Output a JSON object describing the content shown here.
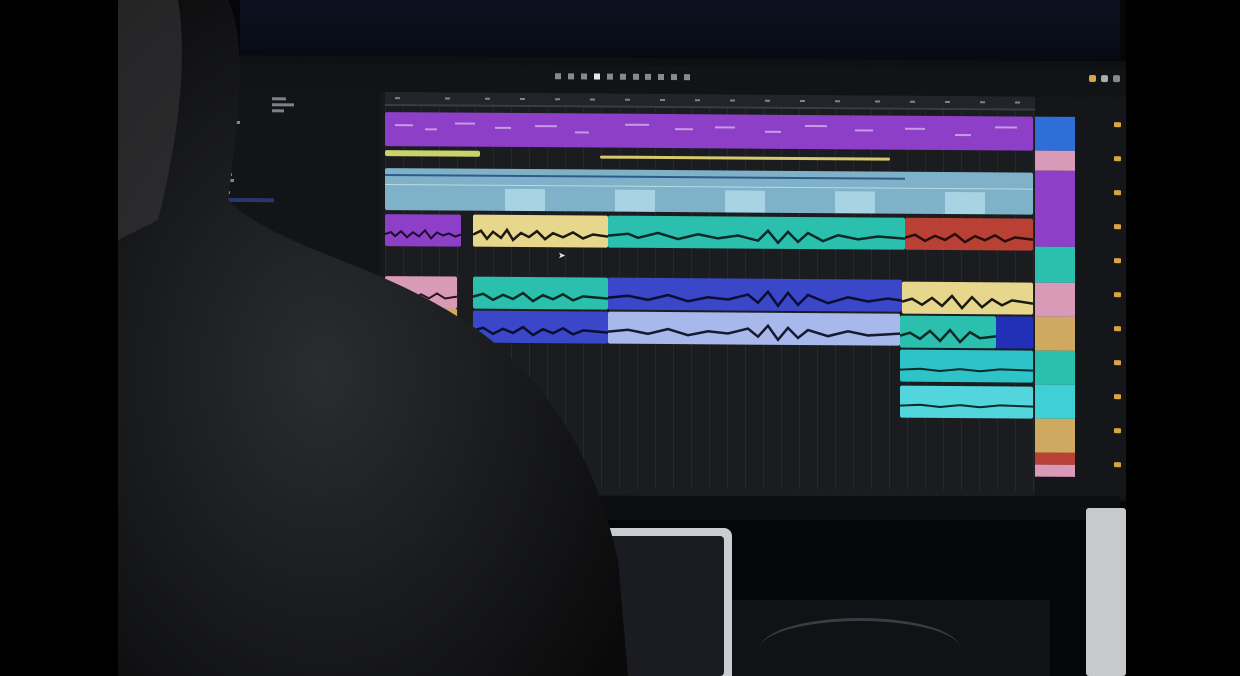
{
  "colors": {
    "purple": "#8d3fc8",
    "yellow": "#e6d78c",
    "teal": "#2bbfae",
    "red": "#b94035",
    "pink": "#d99ab8",
    "tan": "#cfa95f",
    "blue": "#3947c8",
    "lightblue": "#a9b8ea",
    "cyan": "#3fd0d6",
    "skyblock": "#9ed6e6",
    "accent": "#d9a441"
  },
  "icons": {
    "play": "play-icon",
    "stop": "stop-icon",
    "record": "record-icon",
    "cursor": "mouse-pointer-icon"
  },
  "transport": {
    "buttons": [
      "rewind",
      "back",
      "play",
      "stop",
      "record",
      "loop",
      "metronome"
    ]
  },
  "timeline": {
    "lanes": 9
  },
  "mixer": {
    "color_column": [
      "blue",
      "pink",
      "purple",
      "purple",
      "teal",
      "pink",
      "tan",
      "teal",
      "cyan",
      "tan",
      "red"
    ]
  }
}
